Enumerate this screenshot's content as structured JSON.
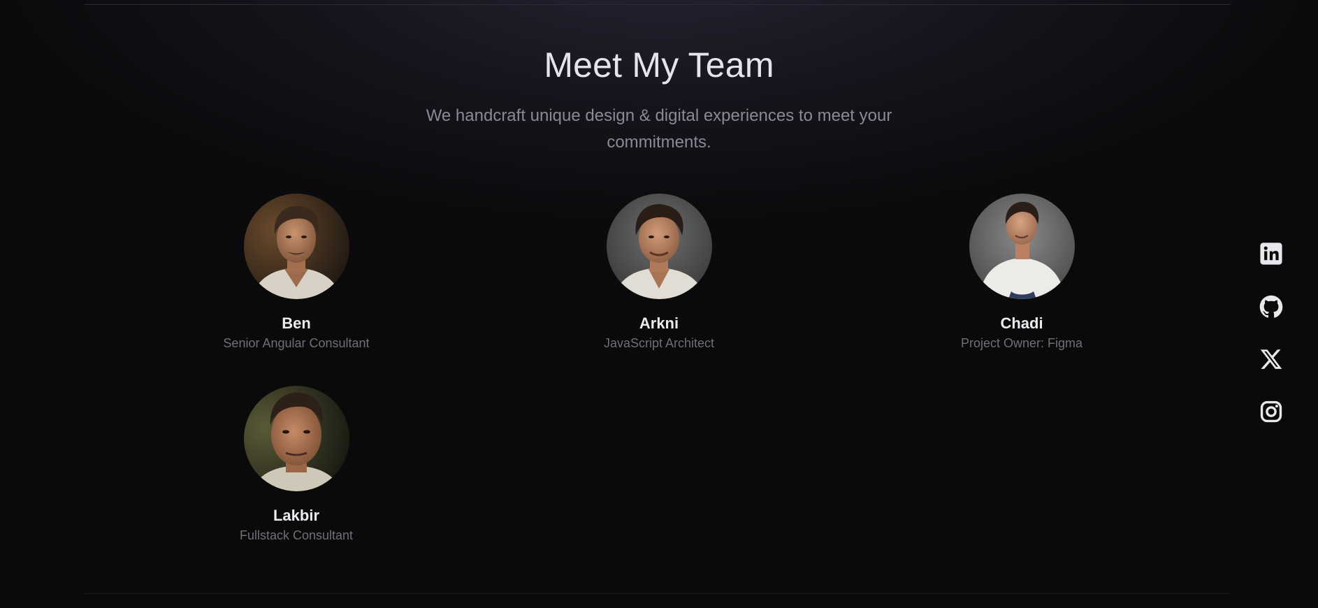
{
  "section": {
    "title": "Meet My Team",
    "subtitle": "We handcraft unique design & digital experiences to meet your commitments."
  },
  "team": [
    {
      "name": "Ben",
      "role": "Senior Angular Consultant"
    },
    {
      "name": "Arkni",
      "role": "JavaScript Architect"
    },
    {
      "name": "Chadi",
      "role": "Project Owner: Figma"
    },
    {
      "name": "Lakbir",
      "role": "Fullstack Consultant"
    }
  ],
  "social": [
    {
      "icon": "linkedin-icon"
    },
    {
      "icon": "github-icon"
    },
    {
      "icon": "x-twitter-icon"
    },
    {
      "icon": "instagram-icon"
    }
  ],
  "colors": {
    "background": "#0a0a0b",
    "title": "#e4e4ea",
    "subtitle": "#8a8a95",
    "name": "#ececf0",
    "role": "#6f6f79",
    "icon": "#e8e8ec"
  }
}
